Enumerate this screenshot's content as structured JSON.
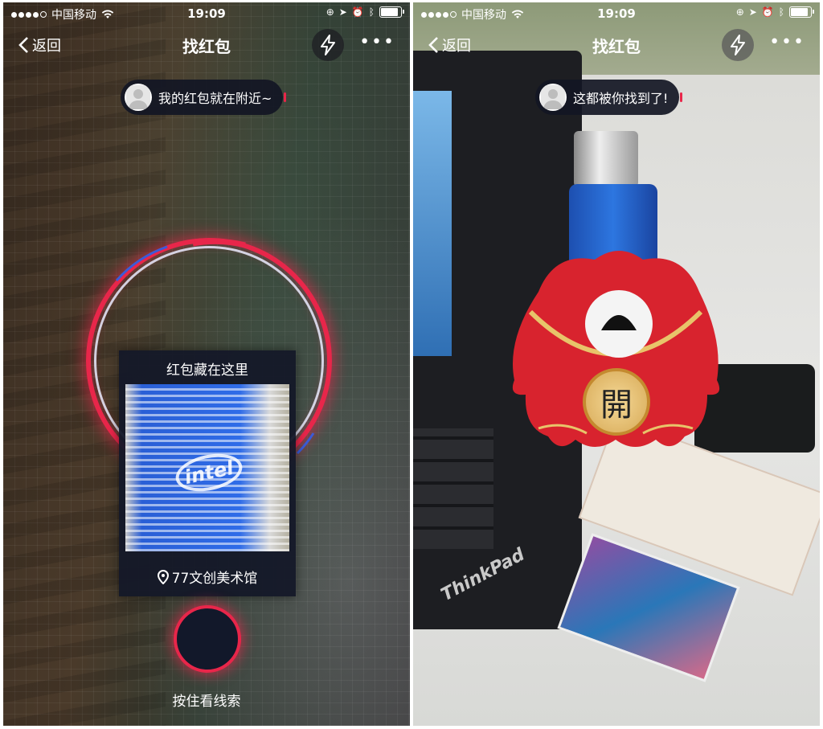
{
  "status_bar": {
    "carrier": "中国移动",
    "time": "19:09"
  },
  "left_screen": {
    "nav": {
      "back_label": "返回",
      "title": "找红包"
    },
    "bubble_text": "我的红包就在附近~",
    "clue_card": {
      "title": "红包藏在这里",
      "image_logo_text": "intel",
      "location": "77文创美术馆"
    },
    "hold_button_label": "按住看线索"
  },
  "right_screen": {
    "nav": {
      "back_label": "返回",
      "title": "找红包"
    },
    "bubble_text": "这都被你找到了!",
    "open_button_label": "開",
    "laptop_brand": "ThinkPad"
  },
  "colors": {
    "accent_red": "#e8264a",
    "card_bg": "#14182a"
  },
  "icons": [
    "back-chevron-icon",
    "flash-icon",
    "more-icon",
    "location-pin-icon",
    "avatar-icon",
    "signal-dots-icon",
    "wifi-icon",
    "battery-icon"
  ]
}
